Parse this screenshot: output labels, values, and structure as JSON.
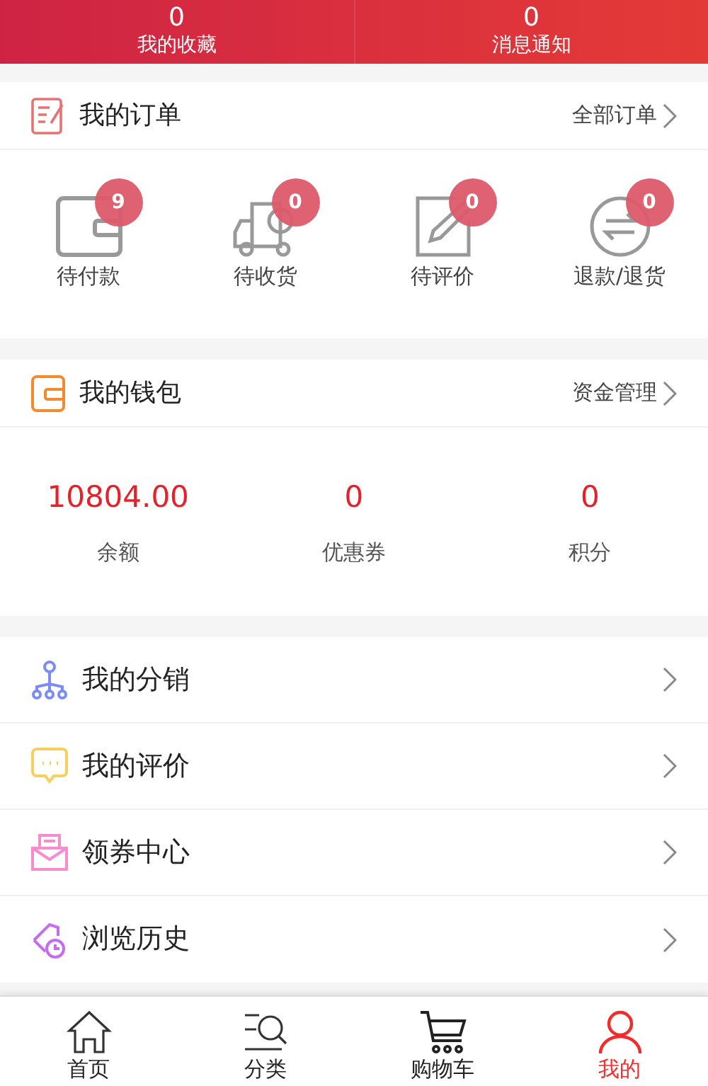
{
  "header_stats": [
    {
      "count": "0",
      "label": "我的收藏"
    },
    {
      "count": "0",
      "label": "消息通知"
    }
  ],
  "orders": {
    "title": "我的订单",
    "link": "全部订单",
    "items": [
      {
        "kind": "wallet",
        "badge": "9",
        "label": "待付款"
      },
      {
        "kind": "truck",
        "badge": "0",
        "label": "待收货"
      },
      {
        "kind": "edit",
        "badge": "0",
        "label": "待评价"
      },
      {
        "kind": "exchange",
        "badge": "0",
        "label": "退款/退货"
      }
    ]
  },
  "wallet": {
    "title": "我的钱包",
    "link": "资金管理",
    "stats": [
      {
        "value": "10804.00",
        "label": "余额"
      },
      {
        "value": "0",
        "label": "优惠券"
      },
      {
        "value": "0",
        "label": "积分"
      }
    ]
  },
  "menu": [
    {
      "kind": "share",
      "label": "我的分销"
    },
    {
      "kind": "chat",
      "label": "我的评价"
    },
    {
      "kind": "mail",
      "label": "领券中心"
    },
    {
      "kind": "history",
      "label": "浏览历史"
    }
  ],
  "tab_bar": [
    {
      "kind": "home",
      "label": "首页",
      "selected": false
    },
    {
      "kind": "category",
      "label": "分类",
      "selected": false
    },
    {
      "kind": "cart",
      "label": "购物车",
      "selected": false
    },
    {
      "kind": "user",
      "label": "我的",
      "selected": true
    }
  ]
}
